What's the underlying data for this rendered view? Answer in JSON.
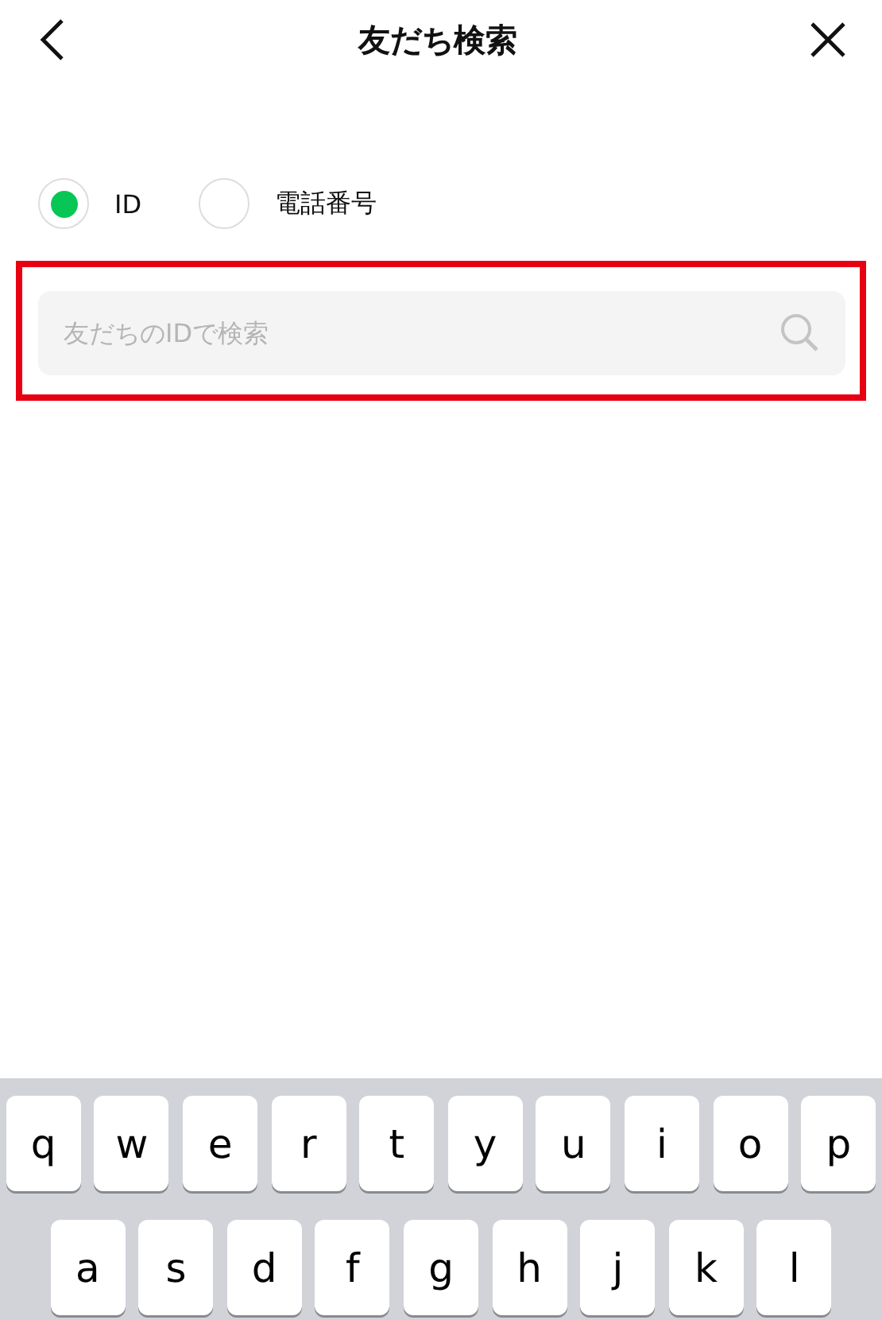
{
  "header": {
    "title": "友だち検索"
  },
  "search_type": [
    {
      "label": "ID",
      "selected": true
    },
    {
      "label": "電話番号",
      "selected": false
    }
  ],
  "search_field": {
    "placeholder": "友だちのIDで検索",
    "highlighted": true
  },
  "keyboard": {
    "rows": [
      [
        "q",
        "w",
        "e",
        "r",
        "t",
        "y",
        "u",
        "i",
        "o",
        "p"
      ],
      [
        "a",
        "s",
        "d",
        "f",
        "g",
        "h",
        "j",
        "k",
        "l"
      ]
    ]
  }
}
